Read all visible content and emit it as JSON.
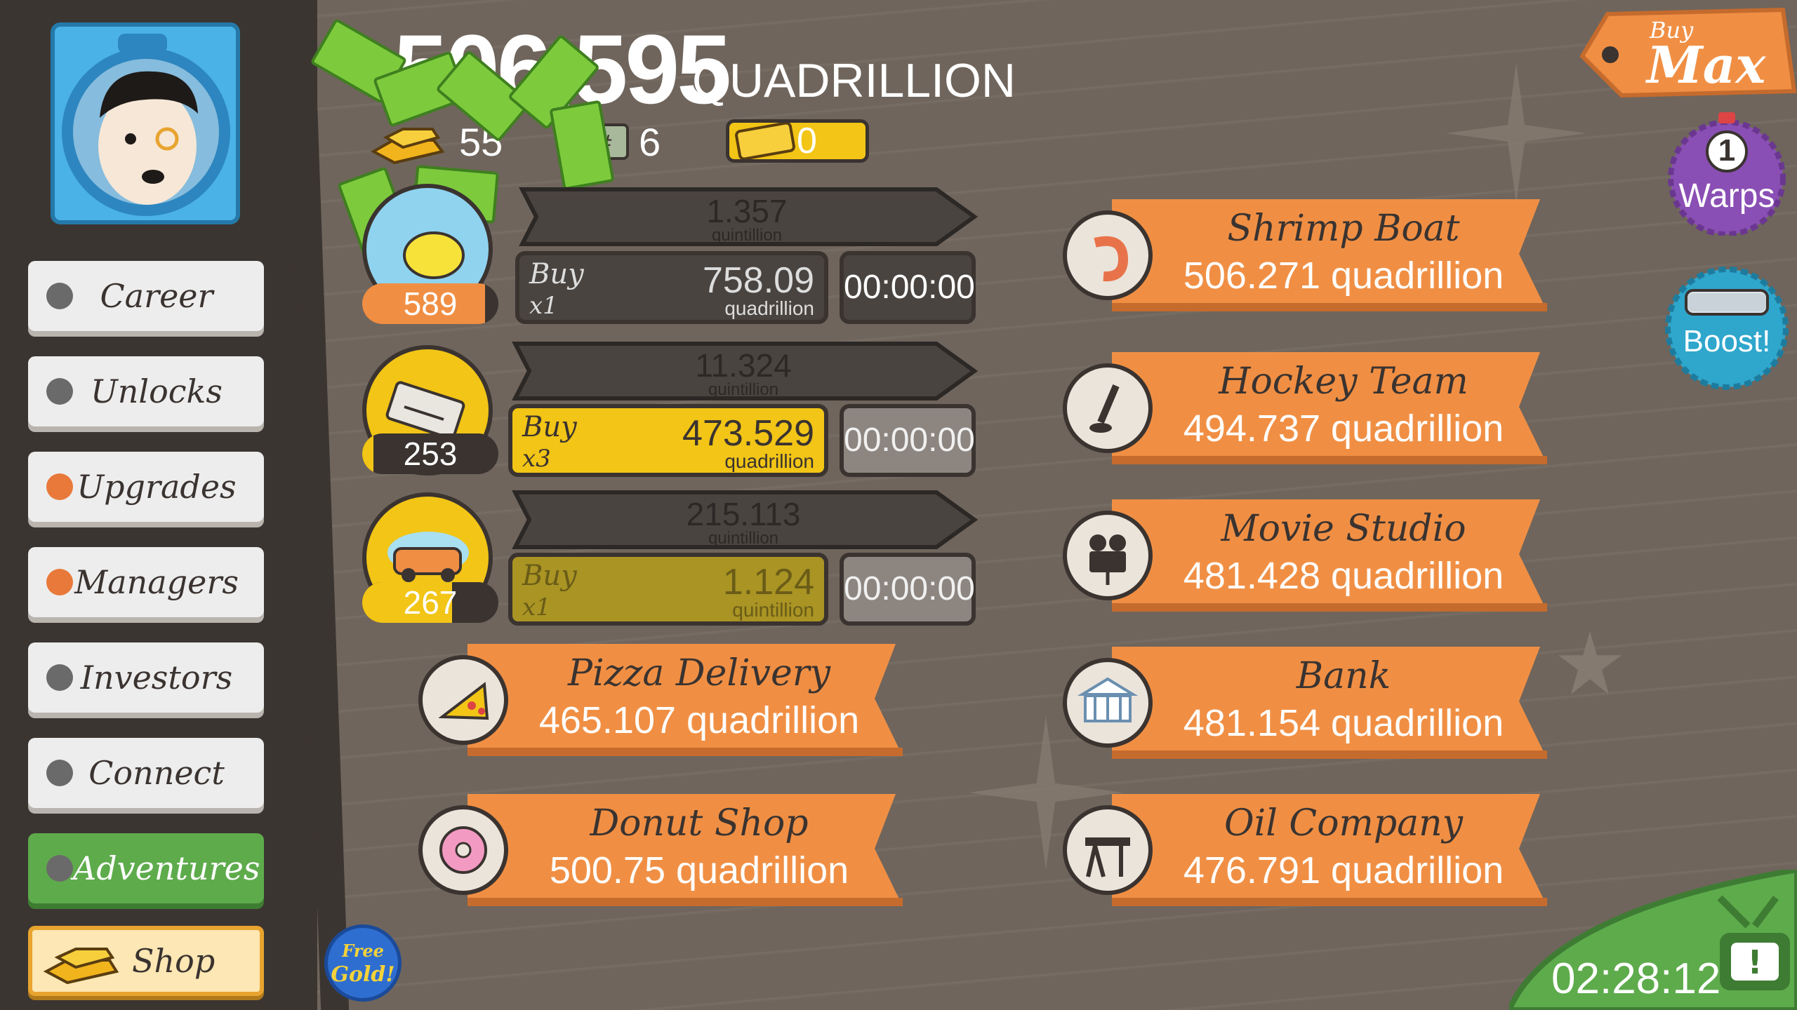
{
  "header": {
    "money": "506,595",
    "money_unit": "QUADRILLION",
    "gold_count": "55",
    "megabucks_count": "6",
    "tickets_count": "0"
  },
  "sidebar": {
    "items": [
      {
        "label": "Career",
        "alert": false
      },
      {
        "label": "Unlocks",
        "alert": false
      },
      {
        "label": "Upgrades",
        "alert": true
      },
      {
        "label": "Managers",
        "alert": true
      },
      {
        "label": "Investors",
        "alert": false
      },
      {
        "label": "Connect",
        "alert": false
      },
      {
        "label": "Adventures",
        "alert": false
      },
      {
        "label": "Shop",
        "alert": false
      }
    ],
    "free_gold": [
      "Free",
      "Gold!"
    ]
  },
  "businesses_active": [
    {
      "icon": "lemon-icon",
      "owned": "589",
      "owned_progress": 0.9,
      "revenue": "1.357",
      "revenue_unit": "quintillion",
      "buy_label": "Buy",
      "buy_mult": "x1",
      "cost": "758.09",
      "cost_unit": "quadrillion",
      "timer": "00:00:00",
      "affordable": false
    },
    {
      "icon": "newspaper-icon",
      "owned": "253",
      "owned_progress": 0.08,
      "revenue": "11.324",
      "revenue_unit": "quintillion",
      "buy_label": "Buy",
      "buy_mult": "x3",
      "cost": "473.529",
      "cost_unit": "quadrillion",
      "timer": "00:00:00",
      "affordable": true
    },
    {
      "icon": "car-wash-icon",
      "owned": "267",
      "owned_progress": 0.66,
      "revenue": "215.113",
      "revenue_unit": "quintillion",
      "buy_label": "Buy",
      "buy_mult": "x1",
      "cost": "1.124",
      "cost_unit": "quintillion",
      "timer": "00:00:00",
      "affordable": false
    }
  ],
  "businesses_locked": [
    {
      "name": "Pizza Delivery",
      "amount": "465.107 quadrillion",
      "icon": "pizza-icon"
    },
    {
      "name": "Donut Shop",
      "amount": "500.75 quadrillion",
      "icon": "donut-icon"
    },
    {
      "name": "Shrimp Boat",
      "amount": "506.271 quadrillion",
      "icon": "shrimp-icon"
    },
    {
      "name": "Hockey Team",
      "amount": "494.737 quadrillion",
      "icon": "hockey-icon"
    },
    {
      "name": "Movie Studio",
      "amount": "481.428 quadrillion",
      "icon": "movie-camera-icon"
    },
    {
      "name": "Bank",
      "amount": "481.154 quadrillion",
      "icon": "bank-icon"
    },
    {
      "name": "Oil Company",
      "amount": "476.791 quadrillion",
      "icon": "oil-derrick-icon"
    }
  ],
  "right_panel": {
    "buy_max_top": "Buy",
    "buy_max_bottom": "Max",
    "warps_count": "1",
    "warps_label": "Warps",
    "boost_label": "Boost!",
    "tv_timer": "02:28:12"
  },
  "colors": {
    "orange": "#f08f44",
    "yellow": "#f2c516",
    "dark": "#3a3330",
    "green": "#5eab4c"
  }
}
